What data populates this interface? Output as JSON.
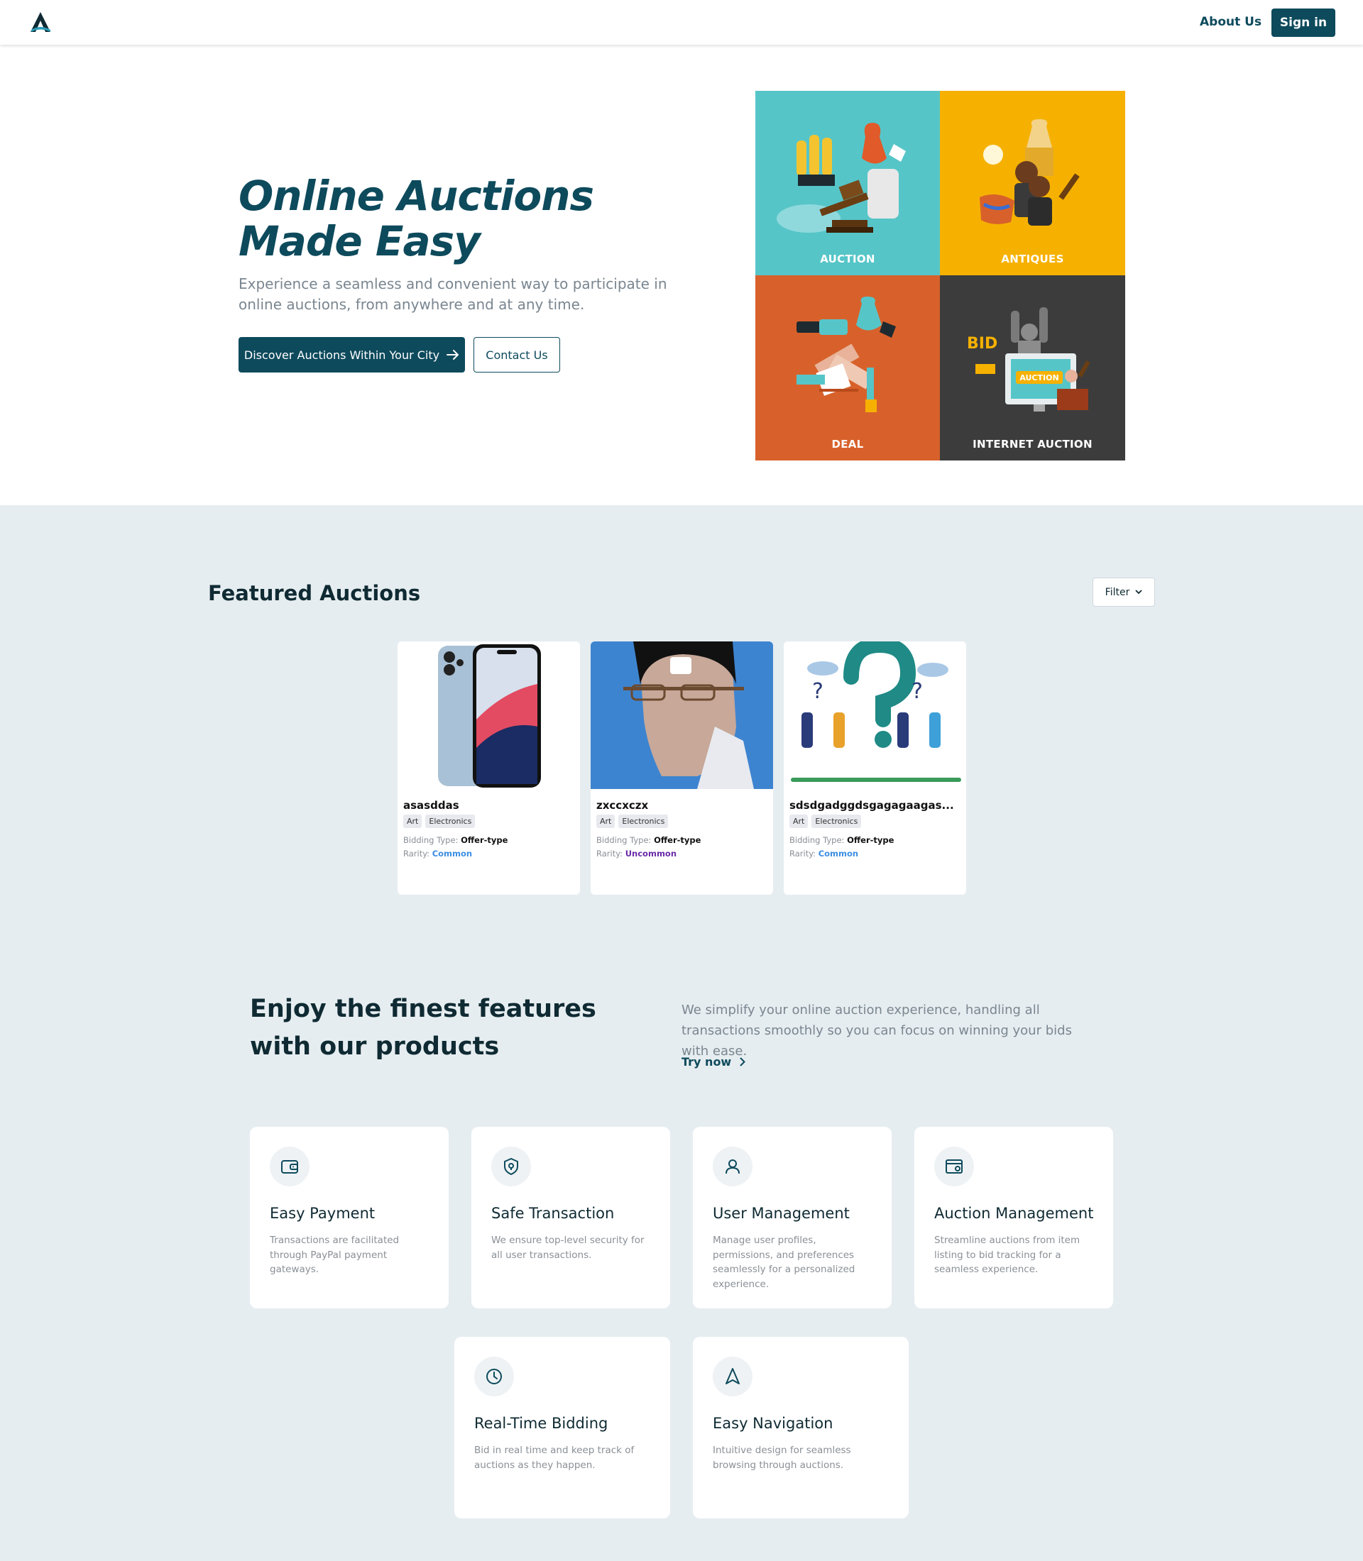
{
  "nav": {
    "about": "About Us",
    "signin": "Sign in"
  },
  "hero": {
    "title": "Online Auctions Made Easy",
    "subtitle": "Experience a seamless and convenient way to participate in online auctions, from anywhere and at any time.",
    "primary_button": "Discover Auctions Within Your City",
    "secondary_button": "Contact Us",
    "tiles": [
      {
        "label": "AUCTION",
        "color": "#56c5c8"
      },
      {
        "label": "ANTIQUES",
        "color": "#f6b100"
      },
      {
        "label": "DEAL",
        "color": "#d8612b"
      },
      {
        "label": "INTERNET AUCTION",
        "color": "#3c3c3c"
      }
    ],
    "tile_words": {
      "bid": "BID",
      "auction": "AUCTION"
    }
  },
  "featured": {
    "title": "Featured Auctions",
    "filter": "Filter",
    "cards": [
      {
        "name": "asasddas",
        "tags": [
          "Art",
          "Electronics"
        ],
        "bidding_label": "Bidding Type:",
        "bidding_value": "Offer-type",
        "rarity_label": "Rarity:",
        "rarity_value": "Common"
      },
      {
        "name": "zxccxczx",
        "tags": [
          "Art",
          "Electronics"
        ],
        "bidding_label": "Bidding Type:",
        "bidding_value": "Offer-type",
        "rarity_label": "Rarity:",
        "rarity_value": "Uncommon"
      },
      {
        "name": "sdsdgadggdsgagagaagas...",
        "tags": [
          "Art",
          "Electronics"
        ],
        "bidding_label": "Bidding Type:",
        "bidding_value": "Offer-type",
        "rarity_label": "Rarity:",
        "rarity_value": "Common"
      }
    ]
  },
  "features": {
    "title": "Enjoy the finest features with our products",
    "text": "We simplify your online auction experience, handling all transactions smoothly so you can focus on winning your bids with ease.",
    "link": "Try now",
    "items": [
      {
        "icon": "wallet-icon",
        "title": "Easy Payment",
        "desc": "Transactions are facilitated through PayPal payment gateways."
      },
      {
        "icon": "shield-icon",
        "title": "Safe Transaction",
        "desc": "We ensure top-level security for all user transactions."
      },
      {
        "icon": "user-icon",
        "title": "User Management",
        "desc": "Manage user profiles, permissions, and preferences seamlessly for a personalized experience."
      },
      {
        "icon": "browser-settings-icon",
        "title": "Auction Management",
        "desc": "Streamline auctions from item listing to bid tracking for a seamless experience."
      },
      {
        "icon": "clock-icon",
        "title": "Real-Time Bidding",
        "desc": "Bid in real time and keep track of auctions as they happen."
      },
      {
        "icon": "navigation-icon",
        "title": "Easy Navigation",
        "desc": "Intuitive design for seamless browsing through auctions."
      }
    ]
  }
}
